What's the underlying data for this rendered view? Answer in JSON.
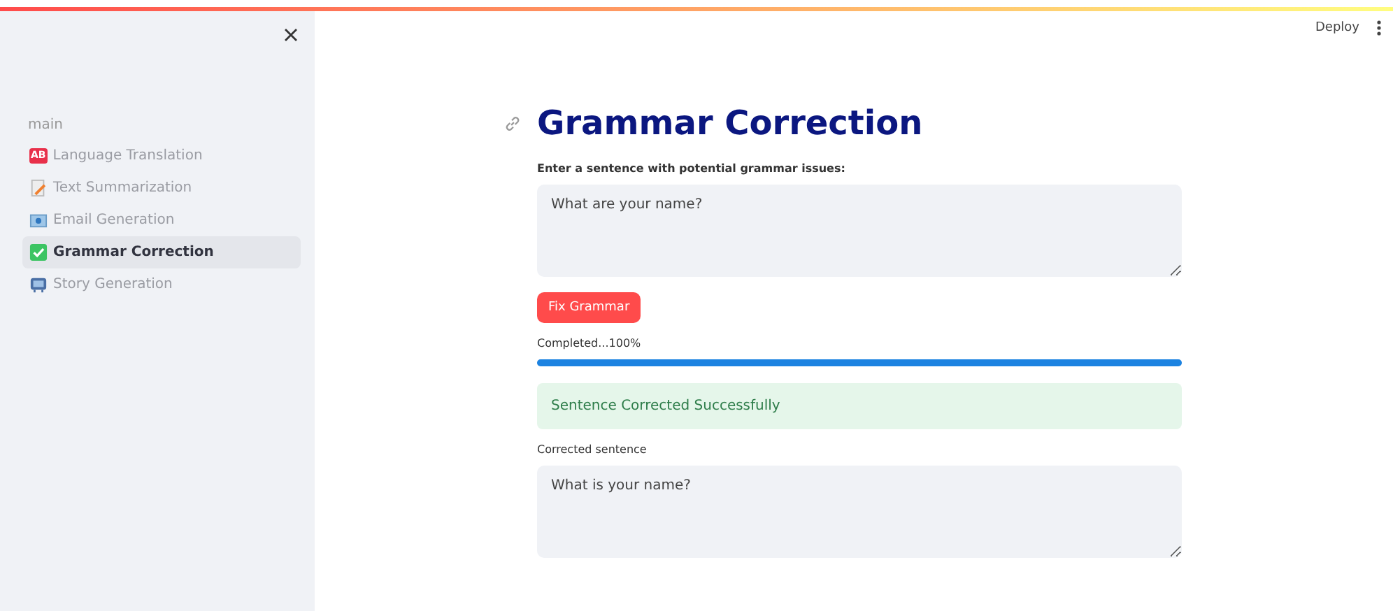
{
  "header": {
    "deploy": "Deploy"
  },
  "sidebar": {
    "section": "main",
    "items": [
      {
        "kind": "ab",
        "badge": "AB",
        "label": "Language Translation",
        "selected": false
      },
      {
        "kind": "memo",
        "label": "Text Summarization",
        "selected": false
      },
      {
        "kind": "mail",
        "label": "Email Generation",
        "selected": false
      },
      {
        "kind": "check",
        "label": "Grammar Correction",
        "selected": true
      },
      {
        "kind": "tv",
        "label": "Story Generation",
        "selected": false
      }
    ]
  },
  "main": {
    "title": "Grammar Correction",
    "input": {
      "label": "Enter a sentence with potential grammar issues:",
      "value": "What are your name?"
    },
    "button": "Fix Grammar",
    "progress": {
      "label": "Completed...100%",
      "level": 1
    },
    "success": "Sentence Corrected Successfully",
    "output": {
      "label": "Corrected sentence",
      "value": "What is your name?"
    }
  }
}
